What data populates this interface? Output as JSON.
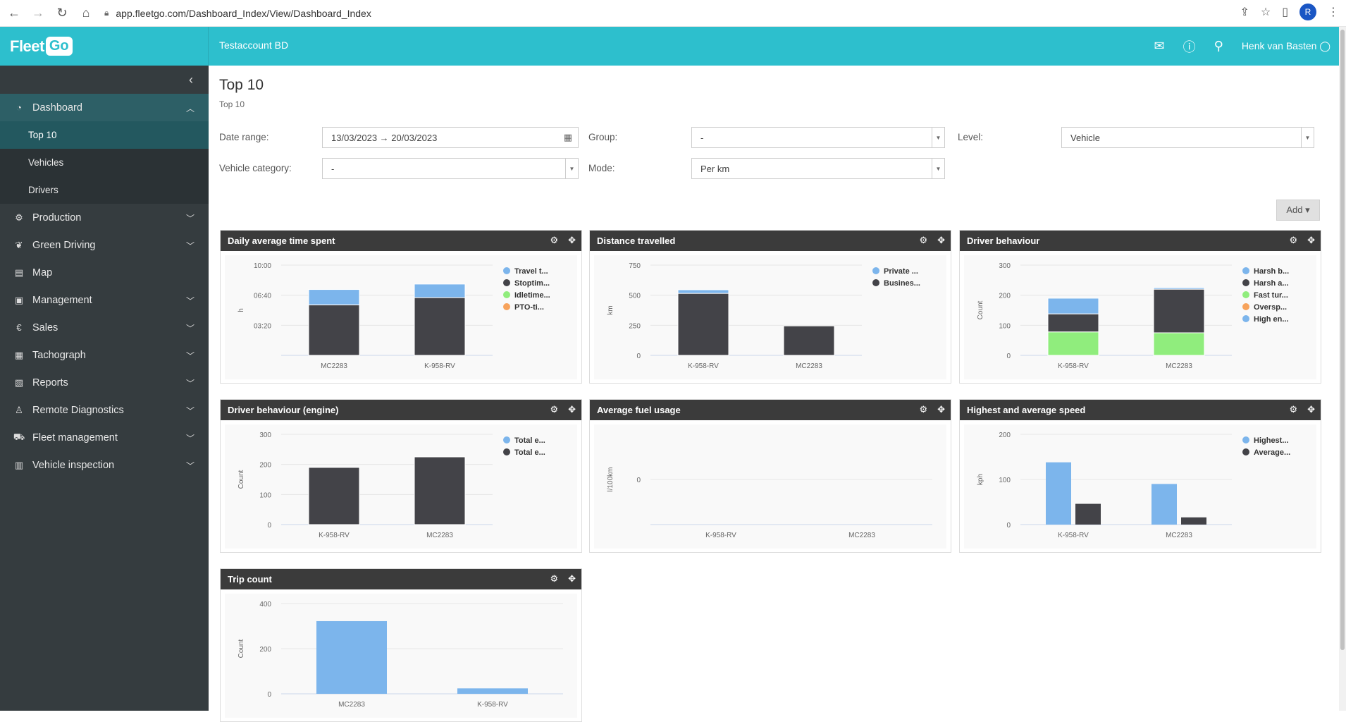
{
  "browser": {
    "url": "app.fleetgo.com/Dashboard_Index/View/Dashboard_Index",
    "profile_initial": "R"
  },
  "header": {
    "logo_text": "Fleet",
    "logo_badge": "Go",
    "account": "Testaccount BD",
    "user": "Henk van Basten"
  },
  "sidebar": {
    "items": [
      {
        "label": "Dashboard",
        "icon": "dashboard-icon",
        "glyph": "◔",
        "expanded": true,
        "active": true,
        "children": [
          {
            "label": "Top 10",
            "active": true
          },
          {
            "label": "Vehicles"
          },
          {
            "label": "Drivers"
          }
        ]
      },
      {
        "label": "Production",
        "icon": "production-icon",
        "glyph": "⚙",
        "chevron": true
      },
      {
        "label": "Green Driving",
        "icon": "leaf-icon",
        "glyph": "❦",
        "chevron": true
      },
      {
        "label": "Map",
        "icon": "map-icon",
        "glyph": "▤"
      },
      {
        "label": "Management",
        "icon": "management-icon",
        "glyph": "▣",
        "chevron": true
      },
      {
        "label": "Sales",
        "icon": "euro-icon",
        "glyph": "€",
        "chevron": true
      },
      {
        "label": "Tachograph",
        "icon": "tachograph-icon",
        "glyph": "▦",
        "chevron": true
      },
      {
        "label": "Reports",
        "icon": "reports-icon",
        "glyph": "▧",
        "chevron": true
      },
      {
        "label": "Remote Diagnostics",
        "icon": "diagnostics-icon",
        "glyph": "♙",
        "chevron": true
      },
      {
        "label": "Fleet management",
        "icon": "fleet-icon",
        "glyph": "⛟",
        "chevron": true
      },
      {
        "label": "Vehicle inspection",
        "icon": "inspection-icon",
        "glyph": "▥",
        "chevron": true
      }
    ]
  },
  "page": {
    "title": "Top 10",
    "subtitle": "Top 10"
  },
  "filters": {
    "date_range_label": "Date range:",
    "date_range_value": "13/03/2023 → 20/03/2023",
    "group_label": "Group:",
    "group_value": "-",
    "level_label": "Level:",
    "level_value": "Vehicle",
    "vehicle_category_label": "Vehicle category:",
    "vehicle_category_value": "-",
    "mode_label": "Mode:",
    "mode_value": "Per km"
  },
  "add_button": "Add ▾",
  "colors": {
    "blue": "#7cb5ec",
    "dark": "#434348",
    "green": "#90ed7d",
    "orange": "#f7a35c"
  },
  "chart_data": [
    {
      "widget_title": "Daily average time spent",
      "type": "bar",
      "stacked": true,
      "categories": [
        "MC2283",
        "K-958-RV"
      ],
      "ylabel": "h",
      "yticks": [
        "03:20",
        "06:40",
        "10:00"
      ],
      "ylim": [
        0,
        10
      ],
      "series": [
        {
          "name": "Travel t...",
          "color": "#7cb5ec",
          "values": [
            1.7,
            1.5
          ]
        },
        {
          "name": "Stoptim...",
          "color": "#434348",
          "values": [
            5.6,
            6.4
          ]
        },
        {
          "name": "Idletime...",
          "color": "#90ed7d",
          "values": [
            0,
            0
          ]
        },
        {
          "name": "PTO-ti...",
          "color": "#f7a35c",
          "values": [
            0,
            0
          ]
        }
      ]
    },
    {
      "widget_title": "Distance travelled",
      "type": "bar",
      "stacked": true,
      "categories": [
        "K-958-RV",
        "MC2283"
      ],
      "ylabel": "km",
      "yticks": [
        "0",
        "250",
        "500",
        "750"
      ],
      "ylim": [
        0,
        750
      ],
      "series": [
        {
          "name": "Private ...",
          "color": "#7cb5ec",
          "values": [
            30,
            0
          ]
        },
        {
          "name": "Busines...",
          "color": "#434348",
          "values": [
            515,
            245
          ]
        }
      ]
    },
    {
      "widget_title": "Driver behaviour",
      "type": "bar",
      "stacked": true,
      "categories": [
        "K-958-RV",
        "MC2283"
      ],
      "ylabel": "Count",
      "yticks": [
        "0",
        "100",
        "200",
        "300"
      ],
      "ylim": [
        0,
        300
      ],
      "series": [
        {
          "name": "Harsh b...",
          "color": "#7cb5ec",
          "values": [
            52,
            5
          ]
        },
        {
          "name": "Harsh a...",
          "color": "#434348",
          "values": [
            60,
            145
          ]
        },
        {
          "name": "Fast tur...",
          "color": "#90ed7d",
          "values": [
            78,
            75
          ]
        },
        {
          "name": "Oversp...",
          "color": "#f7a35c",
          "values": [
            0,
            0
          ]
        },
        {
          "name": "High en...",
          "color": "#7cb5ec",
          "values": [
            0,
            0
          ]
        }
      ]
    },
    {
      "widget_title": "Driver behaviour (engine)",
      "type": "bar",
      "stacked": true,
      "categories": [
        "K-958-RV",
        "MC2283"
      ],
      "ylabel": "Count",
      "yticks": [
        "0",
        "100",
        "200",
        "300"
      ],
      "ylim": [
        0,
        300
      ],
      "series": [
        {
          "name": "Total e...",
          "color": "#7cb5ec",
          "values": [
            0,
            0
          ]
        },
        {
          "name": "Total e...",
          "color": "#434348",
          "values": [
            190,
            225
          ]
        }
      ]
    },
    {
      "widget_title": "Average fuel usage",
      "type": "bar",
      "stacked": false,
      "categories": [
        "K-958-RV",
        "MC2283"
      ],
      "ylabel": "l/100km",
      "yticks": [
        "0"
      ],
      "ylim": [
        0,
        1
      ],
      "series": []
    },
    {
      "widget_title": "Highest and average speed",
      "type": "bar",
      "stacked": false,
      "categories": [
        "K-958-RV",
        "MC2283"
      ],
      "ylabel": "kph",
      "yticks": [
        "0",
        "100",
        "200"
      ],
      "ylim": [
        0,
        200
      ],
      "series": [
        {
          "name": "Highest...",
          "color": "#7cb5ec",
          "values": [
            138,
            90
          ]
        },
        {
          "name": "Average...",
          "color": "#434348",
          "values": [
            46,
            16
          ]
        }
      ]
    },
    {
      "widget_title": "Trip count",
      "type": "bar",
      "stacked": false,
      "categories": [
        "MC2283",
        "K-958-RV"
      ],
      "ylabel": "Count",
      "yticks": [
        "0",
        "200",
        "400"
      ],
      "ylim": [
        0,
        400
      ],
      "series": [
        {
          "name": "",
          "color": "#7cb5ec",
          "values": [
            322,
            24
          ]
        }
      ]
    }
  ]
}
